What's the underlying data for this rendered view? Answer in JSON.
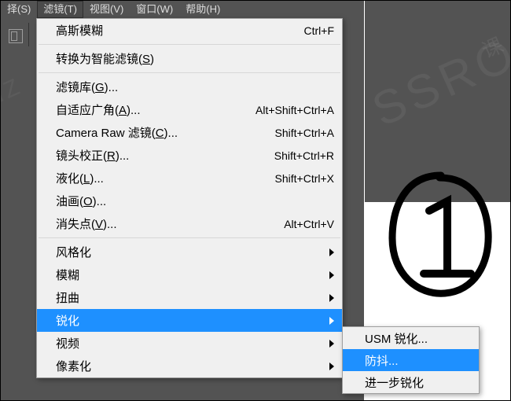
{
  "menubar": {
    "select": "择(S)",
    "filter": "滤镜(T)",
    "view": "视图(V)",
    "window": "窗口(W)",
    "help": "帮助(H)"
  },
  "dropdown": {
    "gaussian_blur": "高斯模糊",
    "gaussian_blur_shortcut": "Ctrl+F",
    "convert_smart": "转换为智能滤镜(",
    "convert_smart_key": "S",
    "convert_smart_close": ")",
    "filter_gallery": "滤镜库(",
    "filter_gallery_key": "G",
    "filter_gallery_close": ")...",
    "adaptive_wide": "自适应广角(",
    "adaptive_wide_key": "A",
    "adaptive_wide_close": ")...",
    "adaptive_wide_shortcut": "Alt+Shift+Ctrl+A",
    "camera_raw": "Camera Raw 滤镜(",
    "camera_raw_key": "C",
    "camera_raw_close": ")...",
    "camera_raw_shortcut": "Shift+Ctrl+A",
    "lens_correction": "镜头校正(",
    "lens_correction_key": "R",
    "lens_correction_close": ")...",
    "lens_correction_shortcut": "Shift+Ctrl+R",
    "liquify": "液化(",
    "liquify_key": "L",
    "liquify_close": ")...",
    "liquify_shortcut": "Shift+Ctrl+X",
    "oil_paint": "油画(",
    "oil_paint_key": "O",
    "oil_paint_close": ")...",
    "vanishing_point": "消失点(",
    "vanishing_point_key": "V",
    "vanishing_point_close": ")...",
    "vanishing_point_shortcut": "Alt+Ctrl+V",
    "stylize": "风格化",
    "blur": "模糊",
    "distort": "扭曲",
    "sharpen": "锐化",
    "video": "视频",
    "pixelate": "像素化"
  },
  "submenu": {
    "usm_sharpen": "USM 锐化...",
    "shake_reduction": "防抖...",
    "sharpen_more": "进一步锐化"
  },
  "watermark": {
    "big": "SSROO",
    "small": "课",
    "nz": "NZ"
  }
}
